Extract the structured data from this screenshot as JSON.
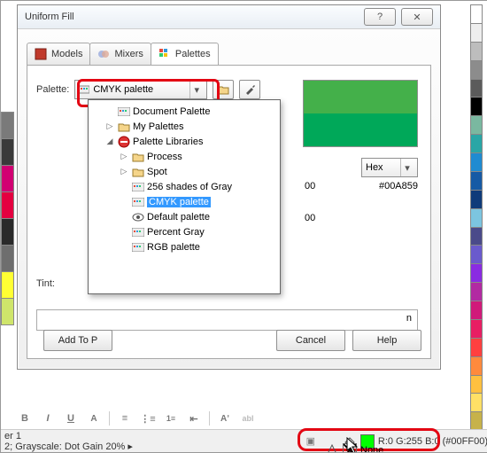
{
  "window": {
    "title": "Uniform Fill"
  },
  "tabs": [
    {
      "label": "Models"
    },
    {
      "label": "Mixers"
    },
    {
      "label": "Palettes"
    }
  ],
  "active_tab": 2,
  "palette": {
    "label": "Palette:",
    "selected": "CMYK palette"
  },
  "tree": {
    "items": [
      {
        "label": "Document Palette",
        "indent": 1,
        "icon": "palette-icon"
      },
      {
        "label": "My Palettes",
        "indent": 1,
        "icon": "folder-icon",
        "twisty": "▷"
      },
      {
        "label": "Palette Libraries",
        "indent": 1,
        "icon": "no-entry-icon",
        "twisty": "◢"
      },
      {
        "label": "Process",
        "indent": 2,
        "icon": "folder-icon",
        "twisty": "▷"
      },
      {
        "label": "Spot",
        "indent": 2,
        "icon": "folder-icon",
        "twisty": "▷"
      },
      {
        "label": "256 shades of Gray",
        "indent": 2,
        "icon": "palette-icon"
      },
      {
        "label": "CMYK palette",
        "indent": 2,
        "icon": "palette-icon",
        "selected": true
      },
      {
        "label": "Default palette",
        "indent": 2,
        "icon": "eye-icon"
      },
      {
        "label": "Percent Gray",
        "indent": 2,
        "icon": "palette-icon"
      },
      {
        "label": "RGB palette",
        "indent": 2,
        "icon": "palette-icon"
      }
    ]
  },
  "preview": {
    "old_color": "#44b04a",
    "new_color": "#00A859"
  },
  "hex": {
    "label": "Hex",
    "old_partial": "00",
    "new_value": "#00A859",
    "row2_partial": "00"
  },
  "tint": {
    "label": "Tint:"
  },
  "name_field": {
    "suffix": "n"
  },
  "buttons": {
    "add": "Add To P",
    "cancel": "Cancel",
    "help": "Help"
  },
  "status": {
    "layer": "er 1",
    "profile": "2; Grayscale: Dot Gain 20%  ▸",
    "fill_text": "R:0 G:255 B:0 (#00FF00)",
    "outline_text": "None",
    "fill_color": "#00FF00"
  },
  "toolbar_icons": [
    "B",
    "I",
    "U",
    "A",
    "align",
    "list-bullet",
    "list-num",
    "indent",
    "text-fit",
    "abl"
  ],
  "left_swatches": [
    "#7a7a7a",
    "#3a3a3a",
    "#d10072",
    "#e40040",
    "#2a2a2a",
    "#6e6e6e",
    "#ffff33",
    "#cfe56b"
  ],
  "right_swatches": [
    "#ffffff",
    "#eeeeee",
    "#bdbdbd",
    "#8c8c8c",
    "#5b5b5b",
    "#000000",
    "#7ab8a0",
    "#2aa6a6",
    "#1f8bd1",
    "#165aa5",
    "#0f3b7a",
    "#7cc5e0",
    "#4a4a8a",
    "#6a5acd",
    "#8a2be2",
    "#b22aa2",
    "#d11a7a",
    "#e81e63",
    "#ff4040",
    "#ff8a3d",
    "#ffc040",
    "#ffe066",
    "#c7b24a"
  ]
}
